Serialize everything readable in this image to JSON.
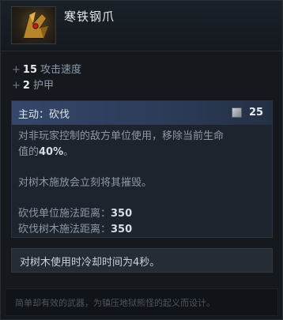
{
  "item": {
    "name": "寒铁钢爪"
  },
  "stats": [
    {
      "plus": "+",
      "value": "15",
      "label": "攻击速度"
    },
    {
      "plus": "+",
      "value": "2",
      "label": "护甲"
    }
  ],
  "ability": {
    "title": "主动：砍伐",
    "cooldown": "25",
    "desc_line1": "对非玩家控制的敌方单位使用，移除当前生命",
    "desc_line2_prefix": "值的",
    "desc_line2_value": "40%",
    "desc_line2_suffix": "。",
    "tree_desc": "对树木施放会立刻将其摧毁。",
    "range_unit_label": "砍伐单位施法距离：",
    "range_unit_value": "350",
    "range_tree_label": "砍伐树木施法距离：",
    "range_tree_value": "350"
  },
  "note": "对树木使用时冷却时间为4秒。",
  "lore": "简单却有效的武器，为镇压地狱熊怪的起义而设计。",
  "colors": {
    "ability_header": "#34466a",
    "panel": "#15191e"
  },
  "icons": {
    "cooldown": "cooldown-icon",
    "item": "claw-item-icon"
  }
}
